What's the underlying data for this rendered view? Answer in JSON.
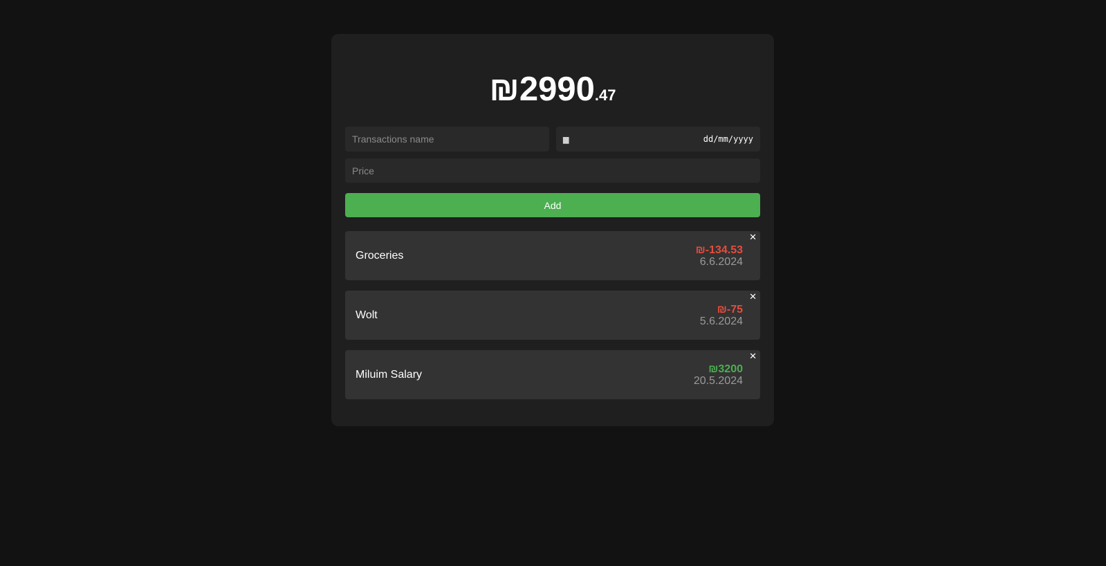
{
  "balance": {
    "whole": "₪2990",
    "cents": ".47"
  },
  "form": {
    "name_placeholder": "Transactions name",
    "date_mask": "dd/mm/yyyy",
    "price_placeholder": "Price",
    "add_label": "Add"
  },
  "transactions": [
    {
      "name": "Groceries",
      "amount": "₪-134.53",
      "date": "6.6.2024",
      "type": "expense",
      "close": "✕"
    },
    {
      "name": "Wolt",
      "amount": "₪-75",
      "date": "5.6.2024",
      "type": "expense",
      "close": "✕"
    },
    {
      "name": "Miluim Salary",
      "amount": "₪3200",
      "date": "20.5.2024",
      "type": "income",
      "close": "✕"
    }
  ],
  "colors": {
    "background": "#121212",
    "card": "#1f1f1f",
    "accent": "#4caf50",
    "expense": "#e74c3c",
    "income": "#4caf50"
  }
}
